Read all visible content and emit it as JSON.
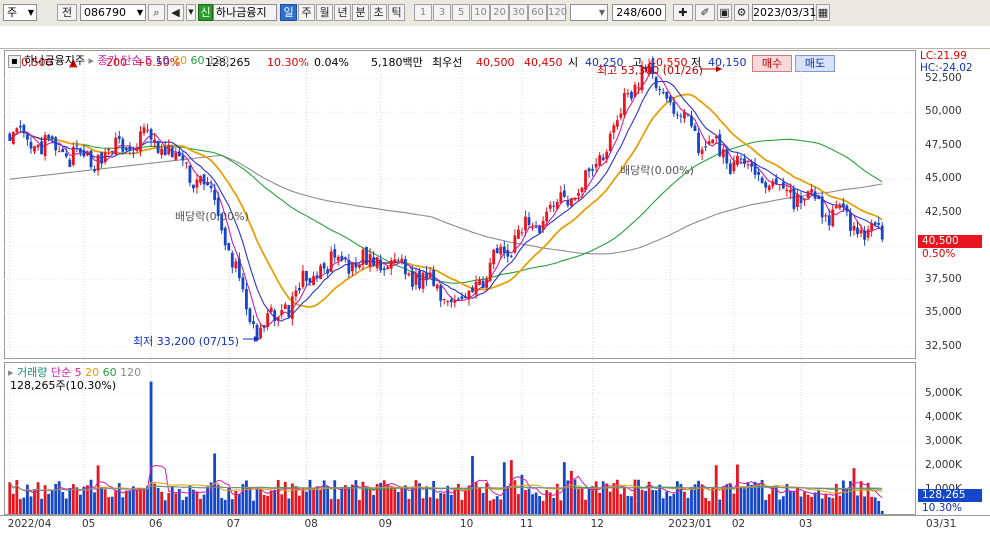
{
  "toolbar": {
    "market_type": "주",
    "prev_label": "전",
    "code": "086790",
    "new_badge": "신",
    "stock_name": "하나금융지",
    "periods": [
      "일",
      "주",
      "월",
      "년",
      "분",
      "초",
      "틱"
    ],
    "selected_period": "일",
    "intervals": [
      "1",
      "3",
      "5",
      "10",
      "20",
      "30",
      "60",
      "120"
    ],
    "count_display": "248/600",
    "date": "2023/03/31"
  },
  "quote": {
    "price": "40,500",
    "change": "200",
    "change_pct": "+0.50%",
    "volume": "128,265",
    "vol_ratio": "10.30%",
    "turnover": "0.04%",
    "amount": "5,180백만",
    "best_label": "최우선",
    "best_ask": "40,500",
    "best_bid": "40,450",
    "open_label": "시",
    "open": "40,250",
    "high_label": "고",
    "high": "40,550",
    "low_label": "저",
    "low": "40,150",
    "buy_label": "매수",
    "sell_label": "매도"
  },
  "price_panel": {
    "legend_name": "하나금융지주",
    "ma_title": "종가 단순",
    "ma_periods": [
      "5",
      "10",
      "20",
      "60",
      "120"
    ],
    "lc": "LC:21.99",
    "hc": "HC:-24.02",
    "current_price": "40,500",
    "current_pct": "0.50%",
    "high_annot": "최고 53,300 (01/26)",
    "low_annot": "최저 33,200 (07/15)",
    "div1": "배당락(0.00%)",
    "div2": "배당락(0.00%)"
  },
  "volume_panel": {
    "legend_title": "거래량",
    "ma_title": "단순",
    "ma_periods": [
      "5",
      "20",
      "60",
      "120"
    ],
    "current_text": "128,265주(10.30%)",
    "current_value": "128,265",
    "current_pct": "10.30%"
  },
  "x_axis": {
    "labels": [
      "2022/04",
      "05",
      "06",
      "07",
      "08",
      "09",
      "10",
      "11",
      "12",
      "2023/01",
      "02",
      "03",
      "03/31"
    ]
  },
  "colors": {
    "up": "#e8141e",
    "down": "#1446c8",
    "ma5": "#d21ea8",
    "ma10": "#2d32d2",
    "ma20": "#e6a00a",
    "ma60": "#28a03c",
    "ma120": "#8c8c8c"
  },
  "chart_data": [
    {
      "type": "candlestick",
      "title": "하나금융지주",
      "ylim": [
        31800,
        54200
      ],
      "yticks": [
        32500,
        35000,
        37500,
        40000,
        42500,
        45000,
        47500,
        50000,
        52500
      ],
      "ytick_labels": [
        "32,500",
        "35,000",
        "37,500",
        "40,000",
        "42,500",
        "45,000",
        "47,500",
        "50,000",
        "52,500"
      ],
      "anchors": [
        {
          "date": "2022/04",
          "close": 48000
        },
        {
          "date": "05",
          "close": 46500
        },
        {
          "date": "06",
          "close": 48000
        },
        {
          "date": "06 mid",
          "close": 44500
        },
        {
          "date": "07/15",
          "close": 33200
        },
        {
          "date": "08",
          "close": 38500
        },
        {
          "date": "09",
          "close": 38800
        },
        {
          "date": "10",
          "close": 36000
        },
        {
          "date": "11",
          "close": 41000
        },
        {
          "date": "12",
          "close": 45500
        },
        {
          "date": "2023/01/26",
          "close": 53300
        },
        {
          "date": "02",
          "close": 47500
        },
        {
          "date": "03",
          "close": 44500
        },
        {
          "date": "03/31",
          "close": 40500
        }
      ]
    },
    {
      "type": "bar",
      "title": "거래량",
      "ylim": [
        0,
        5900
      ],
      "yticks": [
        1000,
        2000,
        3000,
        4000,
        5000
      ],
      "ytick_labels": [
        "1,000K",
        "2,000K",
        "3,000K",
        "4,000K",
        "5,000K"
      ],
      "typical_volume_k": 1200,
      "spike_volume_k": 5500,
      "last_volume_k": 128
    }
  ]
}
